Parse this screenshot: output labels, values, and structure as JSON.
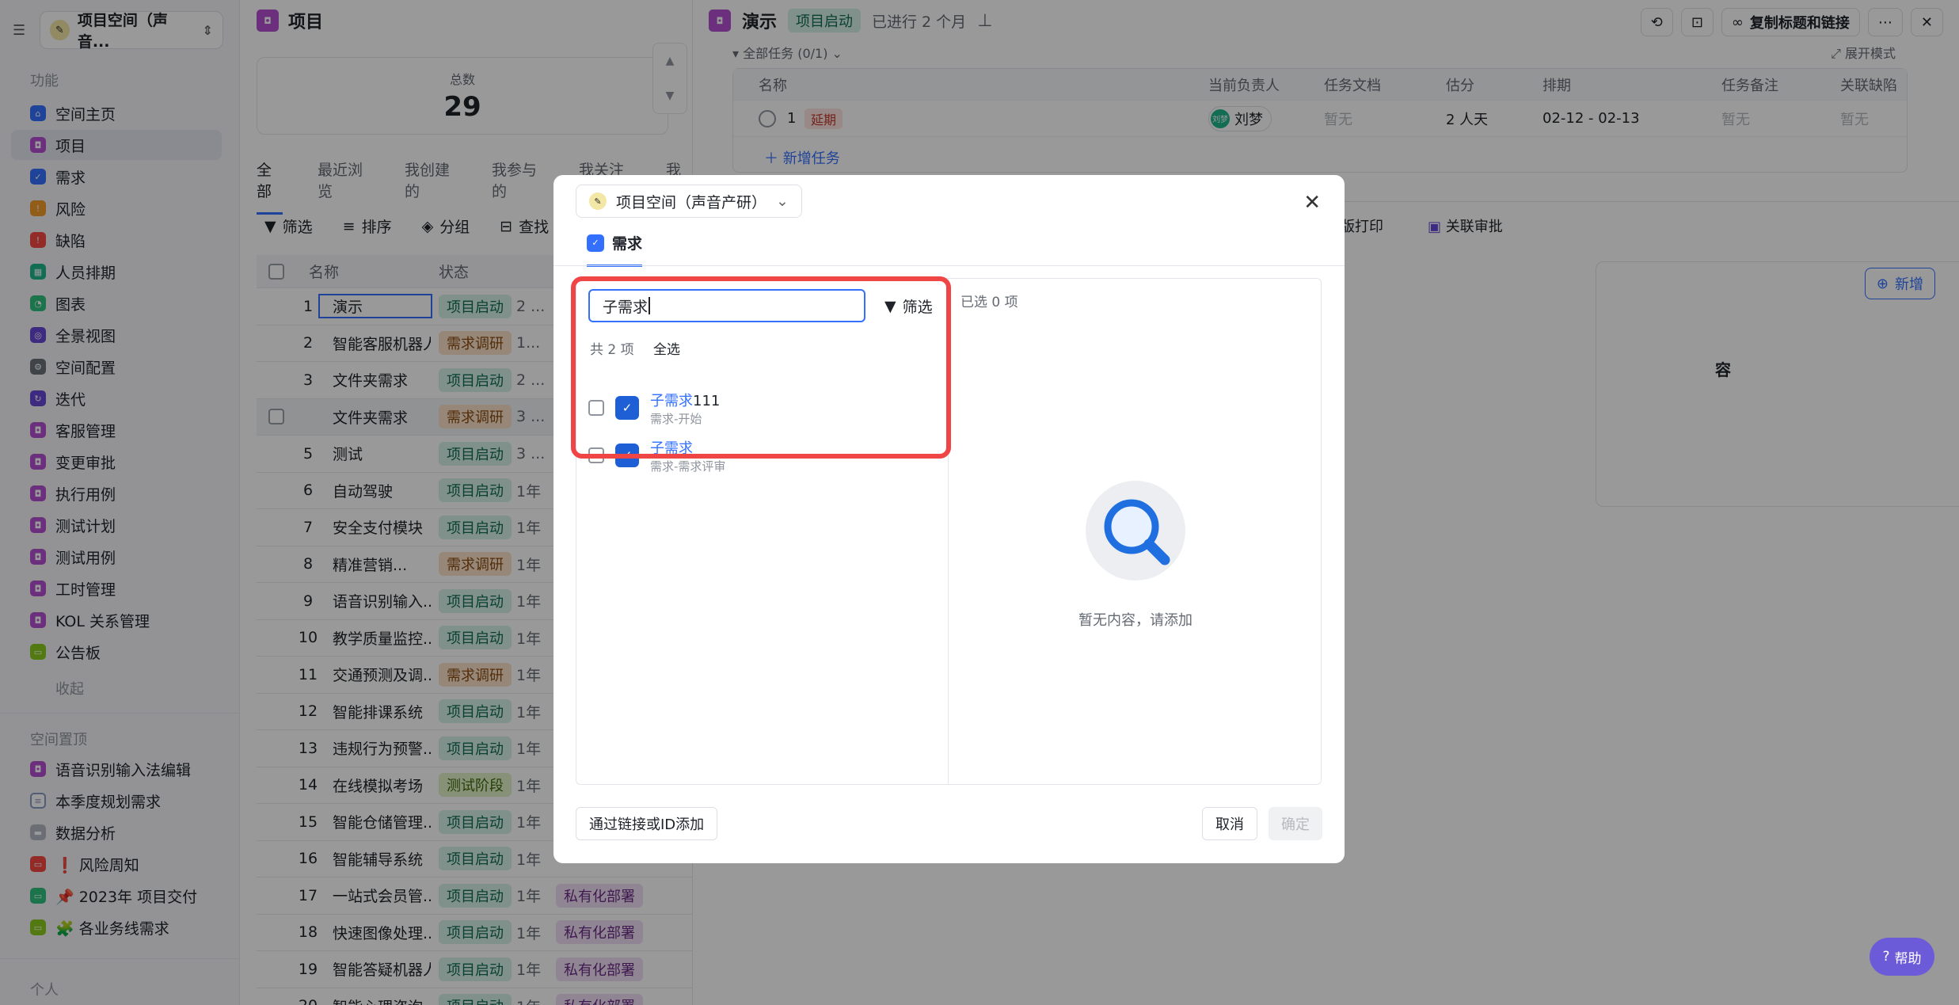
{
  "sidebar": {
    "workspace": "项目空间（声音...",
    "section_features": "功能",
    "items": [
      {
        "label": "空间主页",
        "icon": "home-icon"
      },
      {
        "label": "项目",
        "icon": "project-icon"
      },
      {
        "label": "需求",
        "icon": "requirement-icon"
      },
      {
        "label": "风险",
        "icon": "risk-icon"
      },
      {
        "label": "缺陷",
        "icon": "bug-icon"
      },
      {
        "label": "人员排期",
        "icon": "schedule-icon"
      },
      {
        "label": "图表",
        "icon": "chart-icon"
      },
      {
        "label": "全景视图",
        "icon": "panorama-icon"
      },
      {
        "label": "空间配置",
        "icon": "config-icon"
      },
      {
        "label": "迭代",
        "icon": "iteration-icon"
      },
      {
        "label": "客服管理",
        "icon": "service-icon"
      },
      {
        "label": "变更审批",
        "icon": "approval-icon"
      },
      {
        "label": "执行用例",
        "icon": "case-icon"
      },
      {
        "label": "测试计划",
        "icon": "plan-icon"
      },
      {
        "label": "测试用例",
        "icon": "testcase-icon"
      },
      {
        "label": "工时管理",
        "icon": "hours-icon"
      },
      {
        "label": "KOL 关系管理",
        "icon": "kol-icon"
      },
      {
        "label": "公告板",
        "icon": "board-icon"
      }
    ],
    "collapse": "收起",
    "section_pinned": "空间置顶",
    "pinned": [
      {
        "label": "语音识别输入法编辑",
        "icon": "project-icon"
      },
      {
        "label": "本季度规划需求",
        "icon": "list-icon"
      },
      {
        "label": "数据分析",
        "icon": "folder-icon"
      },
      {
        "label": "❗ 风险周知",
        "icon": "risk-board-icon"
      },
      {
        "label": "📌 2023年 项目交付",
        "icon": "delivery-icon"
      },
      {
        "label": "🧩 各业务线需求",
        "icon": "business-icon"
      }
    ],
    "section_personal": "个人"
  },
  "main": {
    "title": "项目",
    "stat_label": "总数",
    "stat_value": "29",
    "tabs": [
      "全部",
      "最近浏览",
      "我创建的",
      "我参与的",
      "我关注的",
      "我负"
    ],
    "toolbar": [
      "筛选",
      "排序",
      "分组",
      "查找"
    ],
    "columns": [
      "名称",
      "状态"
    ],
    "rows": [
      {
        "idx": "1",
        "name": "演示",
        "status": "项目启动",
        "time": "2 ...",
        "tag2": ""
      },
      {
        "idx": "2",
        "name": "智能客服机器人",
        "status": "需求调研",
        "time": "1...",
        "tag2": ""
      },
      {
        "idx": "3",
        "name": "文件夹需求",
        "status": "项目启动",
        "time": "2 ...",
        "tag2": ""
      },
      {
        "idx": "",
        "name": "文件夹需求",
        "status": "需求调研",
        "time": "3 ...",
        "tag2": ""
      },
      {
        "idx": "5",
        "name": "测试",
        "status": "项目启动",
        "time": "3 ...",
        "tag2": ""
      },
      {
        "idx": "6",
        "name": "自动驾驶",
        "status": "项目启动",
        "time": "1年",
        "tag2": ""
      },
      {
        "idx": "7",
        "name": "安全支付模块",
        "status": "项目启动",
        "time": "1年",
        "tag2": ""
      },
      {
        "idx": "8",
        "name": "精准营销...",
        "status": "需求调研",
        "time": "1年",
        "tag2": ""
      },
      {
        "idx": "9",
        "name": "语音识别输入...",
        "status": "项目启动",
        "time": "1年",
        "tag2": ""
      },
      {
        "idx": "10",
        "name": "教学质量监控...",
        "status": "项目启动",
        "time": "1年",
        "tag2": ""
      },
      {
        "idx": "11",
        "name": "交通预测及调...",
        "status": "需求调研",
        "time": "1年",
        "tag2": ""
      },
      {
        "idx": "12",
        "name": "智能排课系统",
        "status": "项目启动",
        "time": "1年",
        "tag2": ""
      },
      {
        "idx": "13",
        "name": "违规行为预警...",
        "status": "项目启动",
        "time": "1年",
        "tag2": ""
      },
      {
        "idx": "14",
        "name": "在线模拟考场",
        "status": "测试阶段",
        "time": "1年",
        "tag2": ""
      },
      {
        "idx": "15",
        "name": "智能仓储管理...",
        "status": "项目启动",
        "time": "1年",
        "tag2": ""
      },
      {
        "idx": "16",
        "name": "智能辅导系统",
        "status": "项目启动",
        "time": "1年",
        "tag2": ""
      },
      {
        "idx": "17",
        "name": "一站式会员管...",
        "status": "项目启动",
        "time": "1年",
        "tag2": "私有化部署"
      },
      {
        "idx": "18",
        "name": "快速图像处理...",
        "status": "项目启动",
        "time": "1年",
        "tag2": "私有化部署"
      },
      {
        "idx": "19",
        "name": "智能答疑机器人",
        "status": "项目启动",
        "time": "1年",
        "tag2": "私有化部署"
      },
      {
        "idx": "20",
        "name": "智能心理咨询",
        "status": "项目启动",
        "time": "1年",
        "tag2": "私有化部署"
      }
    ]
  },
  "detail": {
    "title": "演示",
    "status": "项目启动",
    "duration": "已进行 2 个月",
    "copy_link": "复制标题和链接",
    "task_header": "全部任务 (0/1)",
    "expand": "展开模式",
    "task_columns": [
      "名称",
      "当前负责人",
      "任务文档",
      "估分",
      "排期",
      "任务备注",
      "关联缺陷"
    ],
    "task": {
      "idx": "1",
      "tag": "延期",
      "owner": "刘梦",
      "owner_initials": "刘梦",
      "doc": "暂无",
      "estimate": "2 人天",
      "schedule": "02-12 - 02-13",
      "note": "暂无",
      "bug": "暂无"
    },
    "add_task": "新增任务",
    "print": "排版打印",
    "related": "关联审批",
    "new": "新增",
    "card_text": "容"
  },
  "modal": {
    "workspace": "项目空间（声音产研）",
    "tab": "需求",
    "search_value": "子需求",
    "filter": "筛选",
    "count": "共 2 项",
    "select_all": "全选",
    "results": [
      {
        "title_hl": "子需求",
        "title_rest": "111",
        "sub": "需求-开始"
      },
      {
        "title_hl": "子需求",
        "title_rest": "",
        "sub": "需求-需求评审"
      }
    ],
    "selected_count": "已选 0 项",
    "empty_text": "暂无内容，请添加",
    "add_by_link": "通过链接或ID添加",
    "cancel": "取消",
    "confirm": "确定"
  },
  "help": "帮助",
  "colors": {
    "accent": "#3370ff",
    "highlight_border": "#f04545",
    "help": "#6b5bd8"
  }
}
